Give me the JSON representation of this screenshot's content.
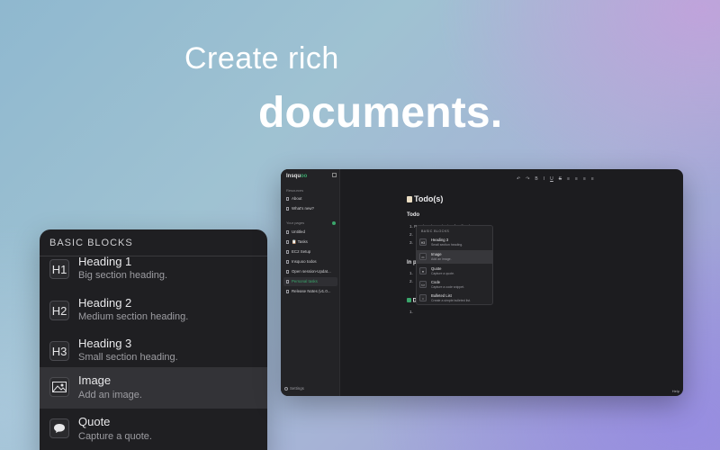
{
  "hero": {
    "line1": "Create rich",
    "line2": "documents."
  },
  "blocks_panel": {
    "title": "BASIC BLOCKS",
    "items": [
      {
        "icon": "H1",
        "name": "Heading 1",
        "desc": "Big section heading."
      },
      {
        "icon": "H2",
        "name": "Heading 2",
        "desc": "Medium section heading."
      },
      {
        "icon": "H3",
        "name": "Heading 3",
        "desc": "Small section heading."
      },
      {
        "icon": "image-icon",
        "name": "Image",
        "desc": "Add an image."
      },
      {
        "icon": "quote-icon",
        "name": "Quote",
        "desc": "Capture a quote."
      }
    ]
  },
  "app": {
    "logo": "Insqu",
    "logo_accent": "oo",
    "sidebar": {
      "section_resources": "Resources",
      "resources": [
        "About",
        "What's new?"
      ],
      "section_pages": "Your pages",
      "pages": [
        "Untitled",
        "📋 Tasks",
        "EC2 Setup",
        "Insquoo todos",
        "Open session-Updat...",
        "Personal tasks",
        "Release Notes (v1.0..."
      ],
      "active_page": "Personal tasks",
      "settings": "Settings"
    },
    "toolbar": [
      "↶",
      "↷",
      "B",
      "I",
      "U",
      "S",
      "≡",
      "≡",
      "≡",
      "≡"
    ],
    "document": {
      "title": "Todo(s)",
      "heading1": "Todo",
      "list1": [
        "1.",
        "2.",
        "3."
      ],
      "line1_text": "Read tools on design feedback",
      "heading2": "In p",
      "list2": [
        "1.",
        "2."
      ],
      "heading3": "D",
      "list3": [
        "1."
      ]
    },
    "mini_menu": {
      "title": "BASIC BLOCKS",
      "items": [
        {
          "icon": "H3",
          "name": "Heading 3",
          "desc": "Small section heading."
        },
        {
          "icon": "image-icon",
          "name": "Image",
          "desc": "Add an image."
        },
        {
          "icon": "quote-icon",
          "name": "Quote",
          "desc": "Capture a quote."
        },
        {
          "icon": "code-icon",
          "name": "Code",
          "desc": "Capture a code snippet."
        },
        {
          "icon": "list-icon",
          "name": "Bulleted List",
          "desc": "Create a simple bulleted list."
        }
      ],
      "active_index": 1
    },
    "help_label": "Help"
  },
  "colors": {
    "accent_green": "#3aa66b",
    "panel_bg": "#1f1f22"
  }
}
